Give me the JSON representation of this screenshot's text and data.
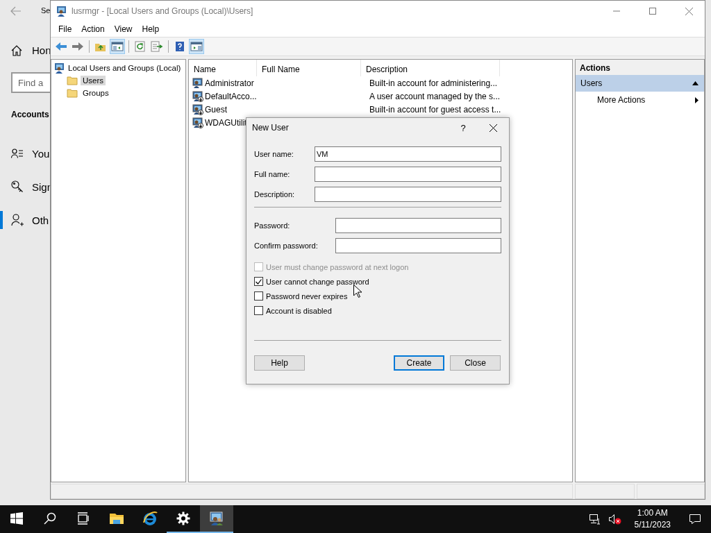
{
  "settings_window": {
    "title": "Se",
    "home": "Hon",
    "search": {
      "placeholder": "Find a"
    },
    "section": "Accounts",
    "items": [
      {
        "label": "You",
        "selected": false
      },
      {
        "label": "Sign",
        "selected": false
      },
      {
        "label": "Oth",
        "selected": true
      }
    ]
  },
  "mmc_window": {
    "title": "lusrmgr - [Local Users and Groups (Local)\\Users]",
    "menu": [
      "File",
      "Action",
      "View",
      "Help"
    ],
    "toolbar": [
      {
        "kind": "back",
        "pressed": false
      },
      {
        "kind": "forward",
        "pressed": false
      },
      {
        "kind": "sep"
      },
      {
        "kind": "up",
        "pressed": false
      },
      {
        "kind": "tree",
        "pressed": true
      },
      {
        "kind": "sep"
      },
      {
        "kind": "refresh",
        "pressed": false
      },
      {
        "kind": "export",
        "pressed": false
      },
      {
        "kind": "sep"
      },
      {
        "kind": "help",
        "pressed": false
      },
      {
        "kind": "actionpane",
        "pressed": true
      }
    ],
    "tree": {
      "label": "Local Users and Groups (Local)",
      "children": [
        {
          "label": "Users",
          "selected": true
        },
        {
          "label": "Groups",
          "selected": false
        }
      ]
    },
    "list": {
      "columns": [
        "Name",
        "Full Name",
        "Description"
      ],
      "rows": [
        {
          "name": "Administrator",
          "description": "Built-in account for administering...",
          "disabled": false
        },
        {
          "name": "DefaultAcco...",
          "description": "A user account managed by the s...",
          "disabled": true
        },
        {
          "name": "Guest",
          "description": "Built-in account for guest access t...",
          "disabled": true
        },
        {
          "name": "WDAGUtilit",
          "disabled": true
        }
      ]
    },
    "actions": {
      "title": "Actions",
      "section": {
        "label": "Users",
        "expanded": true
      },
      "items": [
        "More Actions"
      ]
    }
  },
  "dialog": {
    "title": "New User",
    "help_glyph": "?",
    "fields": [
      {
        "label": "User name:",
        "value": "VM"
      },
      {
        "label": "Full name:"
      },
      {
        "label": "Description:"
      }
    ],
    "password_fields": [
      {
        "label": "Password:"
      },
      {
        "label": "Confirm password:"
      }
    ],
    "options": [
      {
        "label": "User must change password at next logon",
        "checked": false,
        "disabled": true
      },
      {
        "label": "User cannot change password",
        "checked": true,
        "disabled": false
      },
      {
        "label": "Password never expires",
        "checked": false,
        "disabled": false
      },
      {
        "label": "Account is disabled",
        "checked": false,
        "disabled": false
      }
    ],
    "buttons": [
      {
        "label": "Help",
        "default": false
      },
      {
        "label": "Create",
        "default": true
      },
      {
        "label": "Close",
        "default": false
      }
    ]
  },
  "taskbar": {
    "apps": [
      {
        "kind": "start",
        "running": false,
        "active": false
      },
      {
        "kind": "search",
        "running": false,
        "active": false
      },
      {
        "kind": "taskview",
        "running": false,
        "active": false
      },
      {
        "kind": "explorer",
        "running": false,
        "active": false
      },
      {
        "kind": "browser",
        "running": false,
        "active": false
      },
      {
        "kind": "settings",
        "running": true,
        "active": false
      },
      {
        "kind": "mmc",
        "running": true,
        "active": true
      }
    ],
    "time": "1:00 AM",
    "date": "5/11/2023"
  }
}
